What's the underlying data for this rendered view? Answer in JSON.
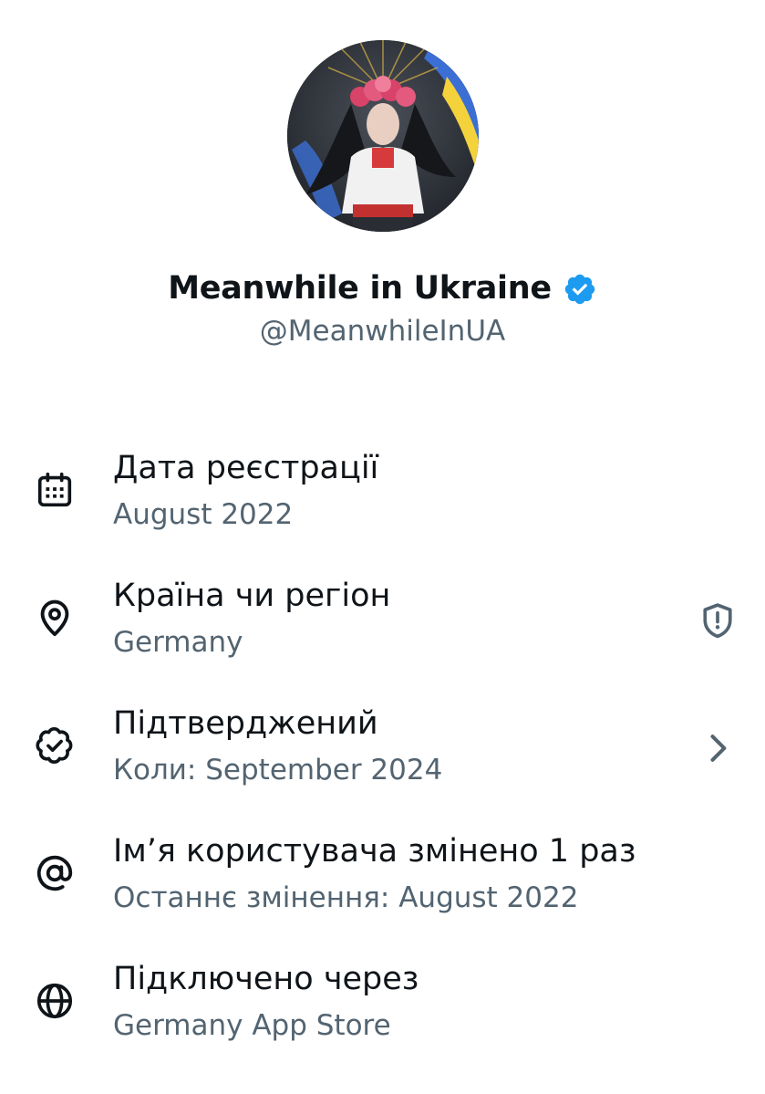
{
  "profile": {
    "display_name": "Meanwhile in Ukraine",
    "handle": "@MeanwhileInUA",
    "verified_color": "#1d9bf0"
  },
  "rows": [
    {
      "icon": "calendar-icon",
      "title": "Дата реєстрації",
      "subtitle": "August 2022"
    },
    {
      "icon": "location-pin-icon",
      "title": "Країна чи регіон",
      "subtitle": "Germany",
      "action_icon": "shield-alert-icon"
    },
    {
      "icon": "verified-outline-icon",
      "title": "Підтверджений",
      "subtitle": "Коли: September 2024",
      "action_icon": "chevron-right-icon"
    },
    {
      "icon": "at-sign-icon",
      "title": "Ім’я користувача змінено 1 раз",
      "subtitle": "Останнє змінення: August 2022"
    },
    {
      "icon": "globe-icon",
      "title": "Підключено через",
      "subtitle": "Germany App Store"
    }
  ],
  "colors": {
    "primary_text": "#0f1419",
    "secondary_text": "#536471",
    "accent": "#1d9bf0"
  }
}
